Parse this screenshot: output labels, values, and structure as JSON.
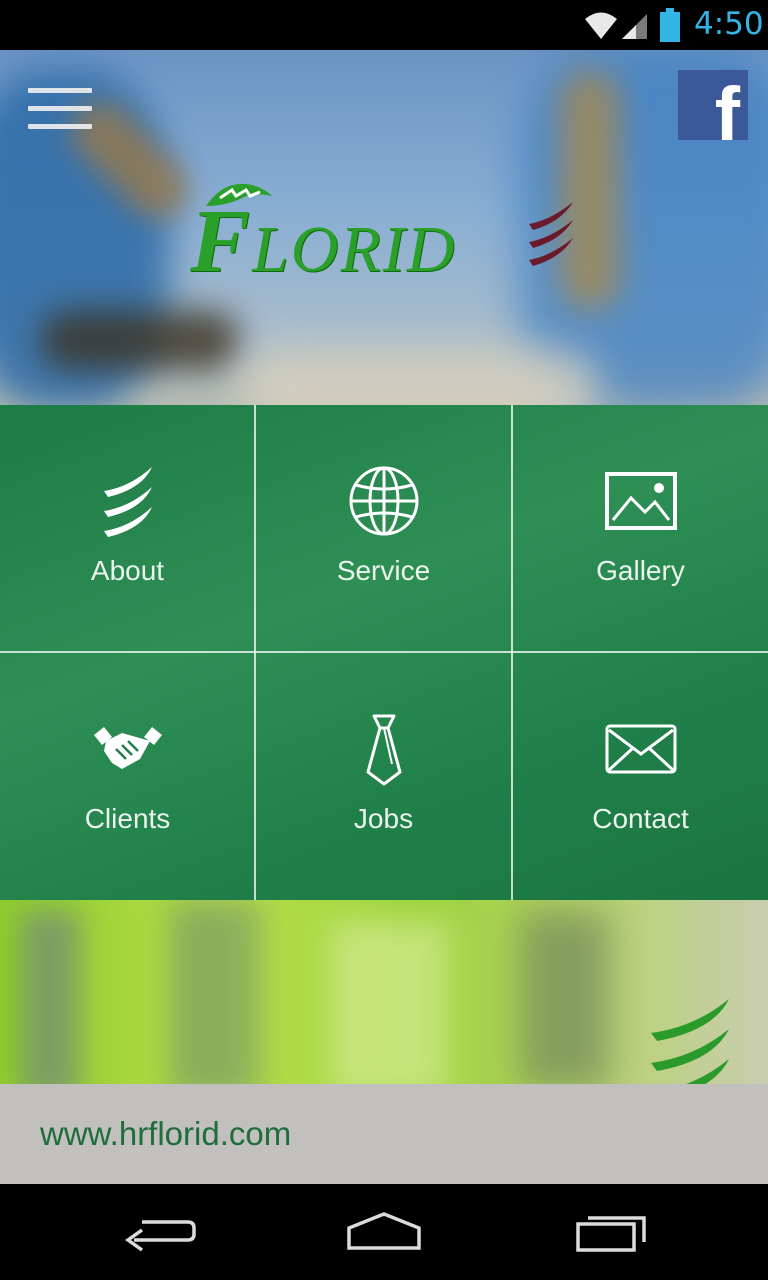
{
  "status_bar": {
    "time": "4:50"
  },
  "header": {
    "logo_text_first": "F",
    "logo_text_rest": "LORID",
    "menu_icon": "hamburger-menu-icon",
    "facebook_icon": "facebook-icon",
    "facebook_glyph": "f"
  },
  "tiles": [
    {
      "label": "About",
      "icon": "florid-wave-icon"
    },
    {
      "label": "Service",
      "icon": "globe-icon"
    },
    {
      "label": "Gallery",
      "icon": "image-icon"
    },
    {
      "label": "Clients",
      "icon": "handshake-icon"
    },
    {
      "label": "Jobs",
      "icon": "necktie-icon"
    },
    {
      "label": "Contact",
      "icon": "envelope-icon"
    }
  ],
  "footer": {
    "url": "www.hrflorid.com"
  },
  "colors": {
    "accent_green": "#2aa02a",
    "tile_green": "#1d7b45",
    "status_blue": "#33b5e5",
    "facebook_blue": "#3b5998"
  }
}
